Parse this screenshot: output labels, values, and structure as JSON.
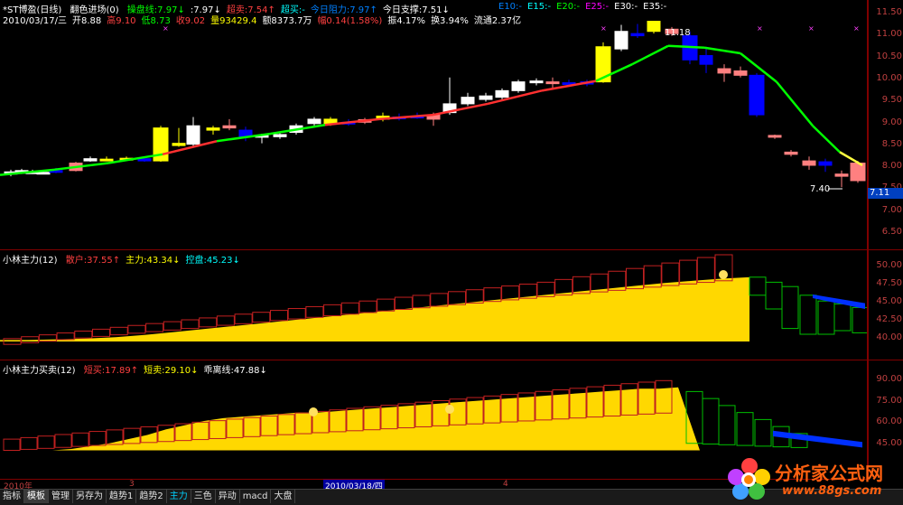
{
  "colors": {
    "up": "#f04040",
    "down": "#00c0ff",
    "grid": "#800000",
    "yellow": "#ffff00",
    "green": "#00ff00"
  },
  "main": {
    "stock_title": "*ST博盈(日线)",
    "indicator_name": "翻色进场(0)",
    "legend": [
      {
        "label": "操盘线:7.97↓",
        "color": "#00ff00"
      },
      {
        "label": ":7.97↓",
        "color": "#ffffff"
      },
      {
        "label": "超卖:7.54↑",
        "color": "#ff4040"
      },
      {
        "label": "超买:-",
        "color": "#00ffff"
      },
      {
        "label": "今日阻力:7.97↑",
        "color": "#0080ff"
      },
      {
        "label": "今日支撑:7.51↓",
        "color": "#ffffff"
      }
    ],
    "ema_legend": [
      {
        "label": "E10:-",
        "color": "#0080ff"
      },
      {
        "label": "E15:-",
        "color": "#00ffff"
      },
      {
        "label": "E20:-",
        "color": "#00ff00"
      },
      {
        "label": "E25:-",
        "color": "#ff00ff"
      },
      {
        "label": "E30:-",
        "color": "#ffffff"
      },
      {
        "label": "E35:-",
        "color": "#ffffff"
      }
    ],
    "info_line": [
      {
        "label": "2010/03/17/三",
        "color": "#ffffff"
      },
      {
        "label": "开8.88",
        "color": "#ffffff"
      },
      {
        "label": "高9.10",
        "color": "#ff4040"
      },
      {
        "label": "低8.73",
        "color": "#00ff00"
      },
      {
        "label": "收9.02",
        "color": "#ff4040"
      },
      {
        "label": "量93429.4",
        "color": "#ffff00"
      },
      {
        "label": "额8373.7万",
        "color": "#ffffff"
      },
      {
        "label": "幅0.14(1.58%)",
        "color": "#ff4040"
      },
      {
        "label": "振4.17%",
        "color": "#ffffff"
      },
      {
        "label": "换3.94%",
        "color": "#ffffff"
      },
      {
        "label": "流通2.37亿",
        "color": "#ffffff"
      }
    ],
    "high_label": "11.18",
    "low_label": "7.40",
    "price_tag": "7.11",
    "axis_ticks": [
      "11.50",
      "11.00",
      "10.50",
      "10.00",
      "9.50",
      "9.00",
      "8.50",
      "8.00",
      "7.50",
      "7.00",
      "6.50"
    ]
  },
  "panel2": {
    "title": "小林主力(12)",
    "legend": [
      {
        "label": "散户:37.55↑",
        "color": "#ff4040"
      },
      {
        "label": "主力:43.34↓",
        "color": "#ffff00"
      },
      {
        "label": "控盘:45.23↓",
        "color": "#00ffff"
      }
    ],
    "axis_ticks": [
      "50.00",
      "47.50",
      "45.00",
      "42.50",
      "40.00"
    ]
  },
  "panel3": {
    "title": "小林主力买卖(12)",
    "legend": [
      {
        "label": "短买:17.89↑",
        "color": "#ff4040"
      },
      {
        "label": "短卖:29.10↓",
        "color": "#ffff00"
      },
      {
        "label": "乖离线:47.88↓",
        "color": "#ffffff"
      }
    ],
    "axis_ticks": [
      "90.00",
      "75.00",
      "60.00",
      "45.00"
    ]
  },
  "date_axis": {
    "year": "2010年",
    "m3": "3",
    "cursor_date": "2010/03/18/四",
    "m4": "4"
  },
  "tabs": [
    "指标",
    "模板",
    "管理",
    "另存为",
    "趋势1",
    "趋势2",
    "主力",
    "三色",
    "异动",
    "macd",
    "大盘"
  ],
  "active_tab": "模板",
  "watermark": {
    "name": "分析家公式网",
    "url": "www.88gs.com"
  }
}
